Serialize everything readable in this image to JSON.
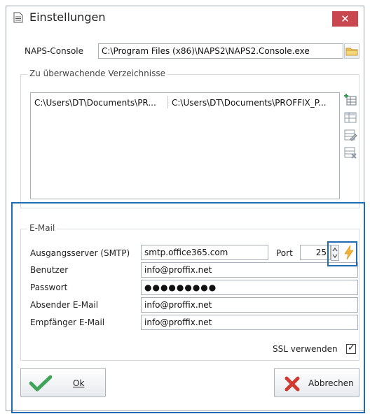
{
  "window": {
    "title": "Einstellungen",
    "close_symbol": "✕",
    "colors": {
      "close": "#c9484f",
      "highlight": "#1f6cb3",
      "ok_check": "#3fa35a",
      "cancel_x": "#d03a30",
      "test_bolt": "#f1b33b"
    }
  },
  "naps": {
    "label": "NAPS-Console",
    "path": "C:\\Program Files (x86)\\NAPS2\\NAPS2.Console.exe",
    "browse_icon": "folder-icon"
  },
  "folders": {
    "legend": "Zu überwachende Verzeichnisse",
    "rows": [
      {
        "col1": "C:\\Users\\DT\\Documents\\PR...",
        "col2": "C:\\Users\\DT\\Documents\\PROFFIX_P..."
      }
    ],
    "side_icons": [
      "add-row-icon",
      "edit-table-icon",
      "edit-row-icon",
      "delete-row-icon"
    ]
  },
  "email": {
    "legend": "E-Mail",
    "smtp_label": "Ausgangsserver (SMTP)",
    "smtp_value": "smtp.office365.com",
    "port_label": "Port",
    "port_value": "25",
    "user_label": "Benutzer",
    "user_value": "info@proffix.net",
    "password_label": "Passwort",
    "password_value": "●●●●●●●●●",
    "sender_label": "Absender E-Mail",
    "sender_value": "info@proffix.net",
    "recipient_label": "Empfänger E-Mail",
    "recipient_value": "info@proffix.net",
    "ssl_label": "SSL verwenden",
    "ssl_checked": true,
    "check_mark": "✓"
  },
  "buttons": {
    "ok_label": "Ok",
    "cancel_label": "Abbrechen"
  }
}
